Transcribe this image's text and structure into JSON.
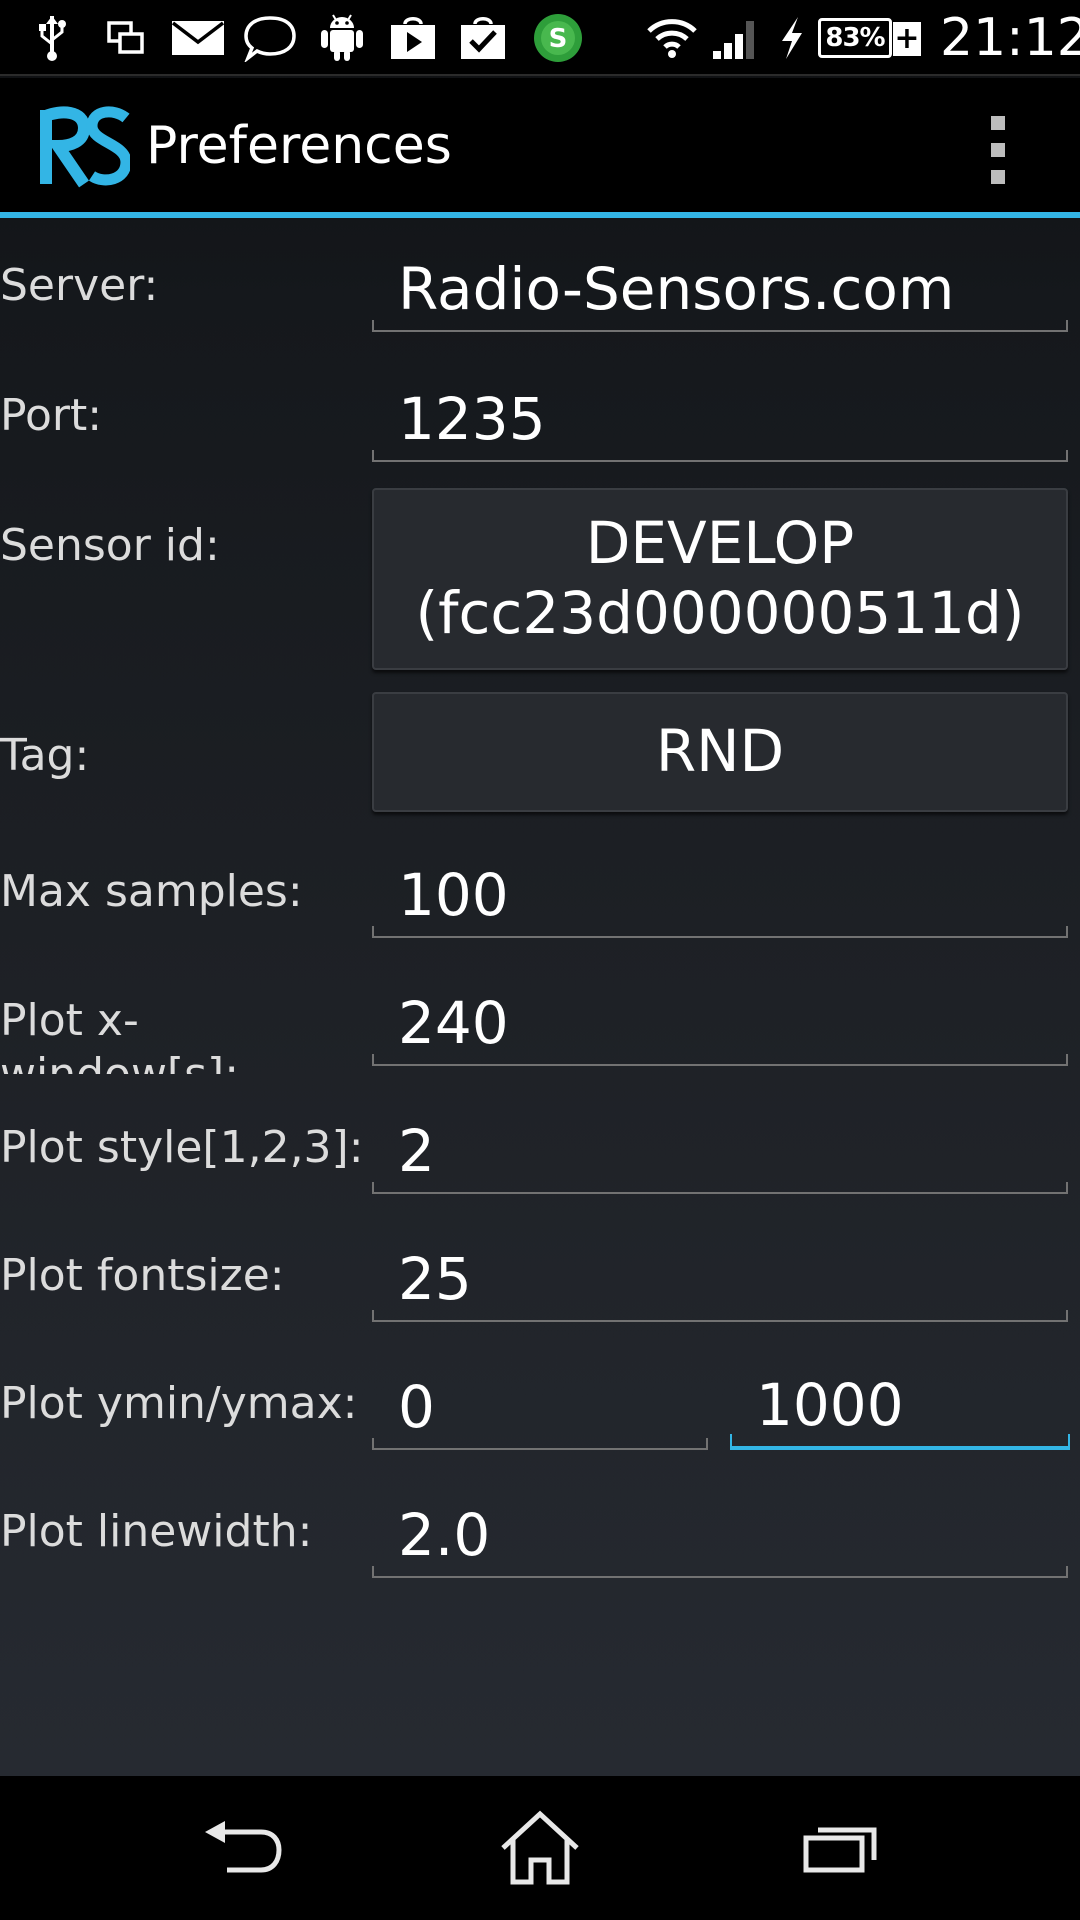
{
  "status_bar": {
    "icons": [
      "usb-icon",
      "screen-mirror-icon",
      "email-icon",
      "chat-bubble-icon",
      "android-icon",
      "play-store-icon",
      "task-check-icon",
      "green-s-app-icon",
      "wifi-icon",
      "cell-signal-icon",
      "charging-bolt-icon",
      "battery-icon"
    ],
    "battery_percent": "83%",
    "battery_plus": "+",
    "time": "21:12"
  },
  "action_bar": {
    "title": "Preferences",
    "logo_letters": "RS",
    "accent_color": "#33b5e5"
  },
  "form": {
    "server": {
      "label": "Server:",
      "value": "Radio-Sensors.com"
    },
    "port": {
      "label": "Port:",
      "value": "1235"
    },
    "sensor_id": {
      "label": "Sensor id:",
      "line1": "DEVELOP",
      "line2": "(fcc23d000000511d)"
    },
    "tag": {
      "label": "Tag:",
      "value": "RND"
    },
    "max_samples": {
      "label": "Max samples:",
      "value": "100"
    },
    "plot_x_window": {
      "label": "Plot x-window[s]:",
      "value": "240"
    },
    "plot_style": {
      "label": "Plot style[1,2,3]:",
      "value": "2"
    },
    "plot_fontsize": {
      "label": "Plot fontsize:",
      "value": "25"
    },
    "plot_ymin_ymax": {
      "label": "Plot ymin/ymax:",
      "ymin": "0",
      "ymax": "1000"
    },
    "plot_linewidth": {
      "label": "Plot linewidth:",
      "value": "2.0"
    }
  },
  "nav_bar": {
    "buttons": [
      "back-icon",
      "home-icon",
      "recent-apps-icon"
    ]
  }
}
